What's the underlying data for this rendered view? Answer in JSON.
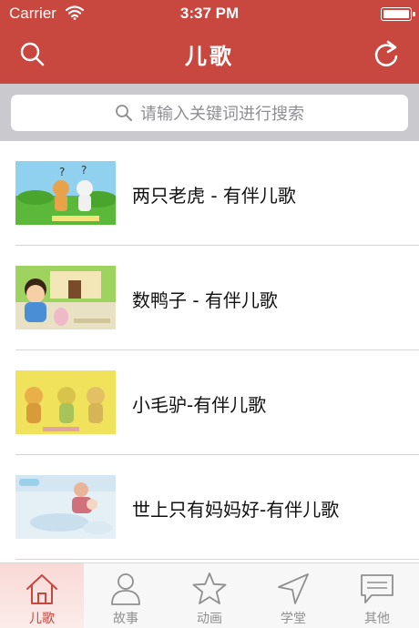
{
  "status_bar": {
    "carrier": "Carrier",
    "time": "3:37 PM"
  },
  "nav": {
    "title": "儿歌",
    "left_icon": "search-icon",
    "right_icon": "refresh-icon"
  },
  "search": {
    "placeholder": "请输入关键词进行搜索"
  },
  "songs": [
    {
      "title": "两只老虎 - 有伴儿歌"
    },
    {
      "title": "数鸭子 - 有伴儿歌"
    },
    {
      "title": "小毛驴-有伴儿歌"
    },
    {
      "title": "世上只有妈妈好-有伴儿歌"
    }
  ],
  "tabs": [
    {
      "label": "儿歌",
      "icon": "home-icon",
      "active": true
    },
    {
      "label": "故事",
      "icon": "person-icon",
      "active": false
    },
    {
      "label": "动画",
      "icon": "star-icon",
      "active": false
    },
    {
      "label": "学堂",
      "icon": "navigation-arrow-icon",
      "active": false
    },
    {
      "label": "其他",
      "icon": "message-icon",
      "active": false
    }
  ],
  "colors": {
    "accent": "#c8473f",
    "tab_inactive": "#8f8f8f",
    "search_area": "#c9c9ce"
  }
}
